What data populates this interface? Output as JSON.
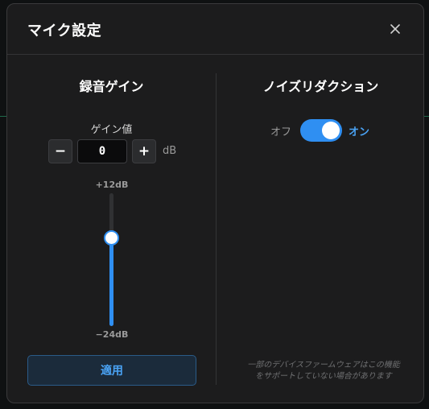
{
  "dialog": {
    "title": "マイク設定"
  },
  "gain": {
    "section_title": "録音ゲイン",
    "value_label": "ゲイン値",
    "value": "0",
    "unit": "dB",
    "minus_label": "−",
    "plus_label": "+",
    "slider": {
      "max_label": "+12dB",
      "min_label": "−24dB",
      "min": -24,
      "max": 12,
      "value": 0
    },
    "apply_label": "適用"
  },
  "noise_reduction": {
    "section_title": "ノイズリダクション",
    "off_label": "オフ",
    "on_label": "オン",
    "enabled": true,
    "note_line1": "一部のデバイスファームウェアはこの機能",
    "note_line2": "をサポートしていない場合があります"
  },
  "colors": {
    "accent": "#2f8ff2",
    "accent_text": "#4aa3f5",
    "background": "#1c1c1d"
  }
}
